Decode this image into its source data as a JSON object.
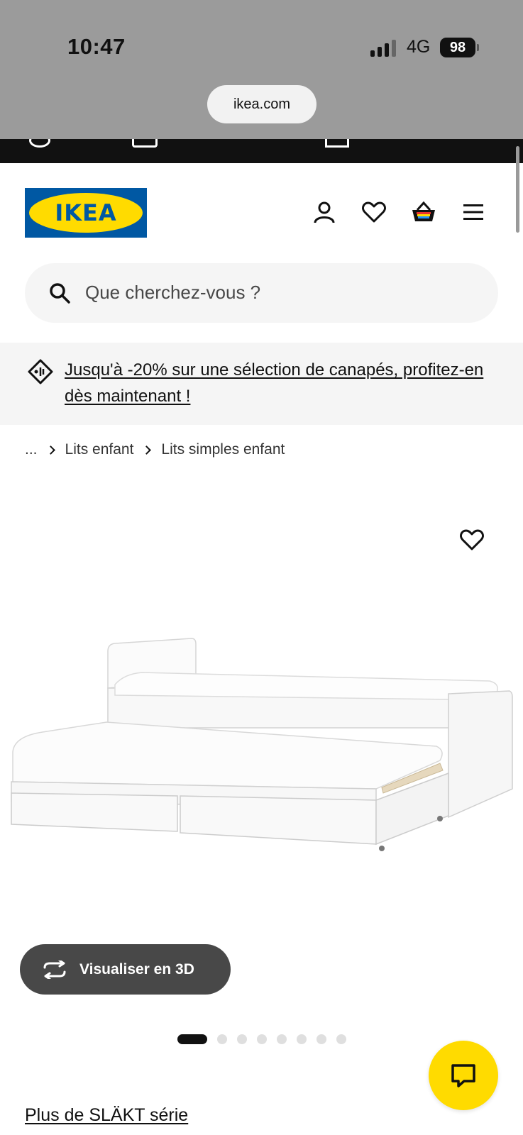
{
  "status_bar": {
    "time": "10:47",
    "network": "4G",
    "battery": "98"
  },
  "browser": {
    "url": "ikea.com"
  },
  "header": {
    "logo_text": "IKEA",
    "icons": [
      "profile-icon",
      "heart-icon",
      "basket-icon",
      "menu-icon"
    ]
  },
  "search": {
    "placeholder": "Que cherchez-vous ?"
  },
  "promo": {
    "text": "Jusqu'à -20% sur une sélection de canapés, profitez-en dès maintenant !"
  },
  "breadcrumb": {
    "items": [
      "...",
      "Lits enfant",
      "Lits simples enfant"
    ]
  },
  "product": {
    "view_3d_label": "Visualiser en 3D",
    "image_count": 8,
    "active_image": 1,
    "series_link": "Plus de SLÄKT série"
  },
  "colors": {
    "ikea_blue": "#0058a3",
    "ikea_yellow": "#ffdb00",
    "dark": "#111111",
    "button_grey": "#484848"
  }
}
